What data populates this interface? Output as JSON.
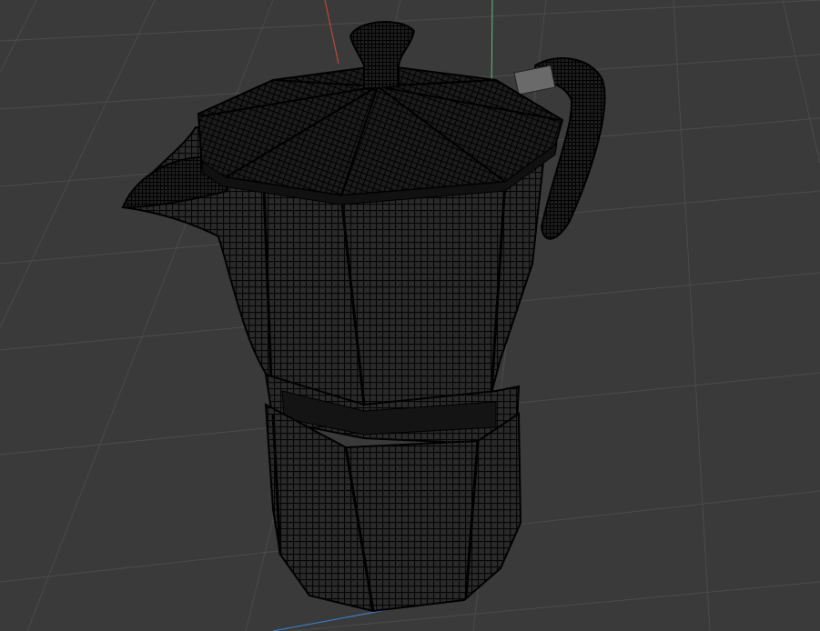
{
  "viewport": {
    "background": "#3a3a3a",
    "grid_color": "#4b4b4b",
    "axis_colors": {
      "x": "#d24a3a",
      "y": "#5bbf7a",
      "z": "#3d86d8"
    },
    "model": {
      "name": "moka-pot",
      "display_mode": "wireframe",
      "fill_color": "#2a2a2a",
      "wire_color": "#050505"
    }
  }
}
